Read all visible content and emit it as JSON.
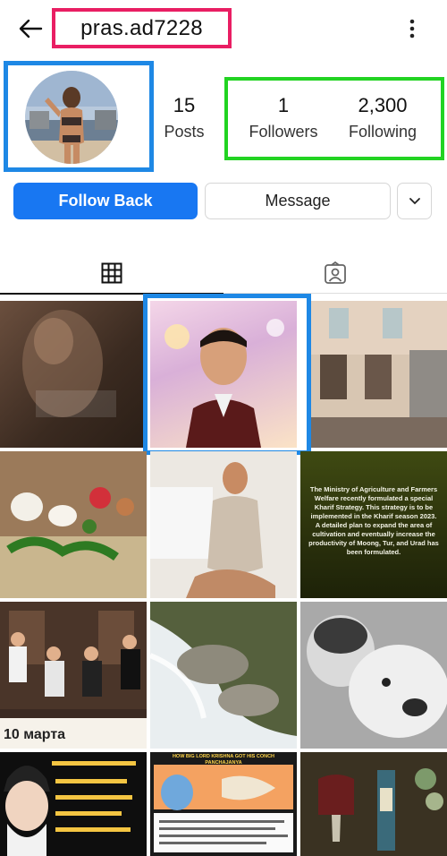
{
  "header": {
    "username": "pras.ad7228",
    "back_icon": "back-arrow-icon",
    "more_icon": "more-vertical-icon"
  },
  "profile": {
    "posts": {
      "count": "15",
      "label": "Posts"
    },
    "followers": {
      "count": "1",
      "label": "Followers"
    },
    "following": {
      "count": "2,300",
      "label": "Following"
    }
  },
  "actions": {
    "follow_back": "Follow Back",
    "message": "Message",
    "more_icon": "chevron-down-icon"
  },
  "tabs": [
    {
      "name": "grid",
      "icon": "grid-icon",
      "active": true
    },
    {
      "name": "tagged",
      "icon": "tagged-person-icon",
      "active": false
    }
  ],
  "grid": {
    "post_6_text": "The Ministry of Agriculture and Farmers Welfare recently formulated a special Kharif Strategy. This strategy is to be implemented in the Kharif season 2023. A detailed plan to expand the area of cultivation and eventually increase the productivity of Moong, Tur, and Urad has been formulated.",
    "post_7_caption": "10 марта",
    "post_8_header": "HOW BIG LORD KRISHNA GOT HIS CONCH PANCHAJANYA"
  },
  "colors": {
    "accent_blue": "#1877f2",
    "highlight_pink": "#e91e63",
    "highlight_blue": "#1e88e5",
    "highlight_green": "#22d322"
  }
}
